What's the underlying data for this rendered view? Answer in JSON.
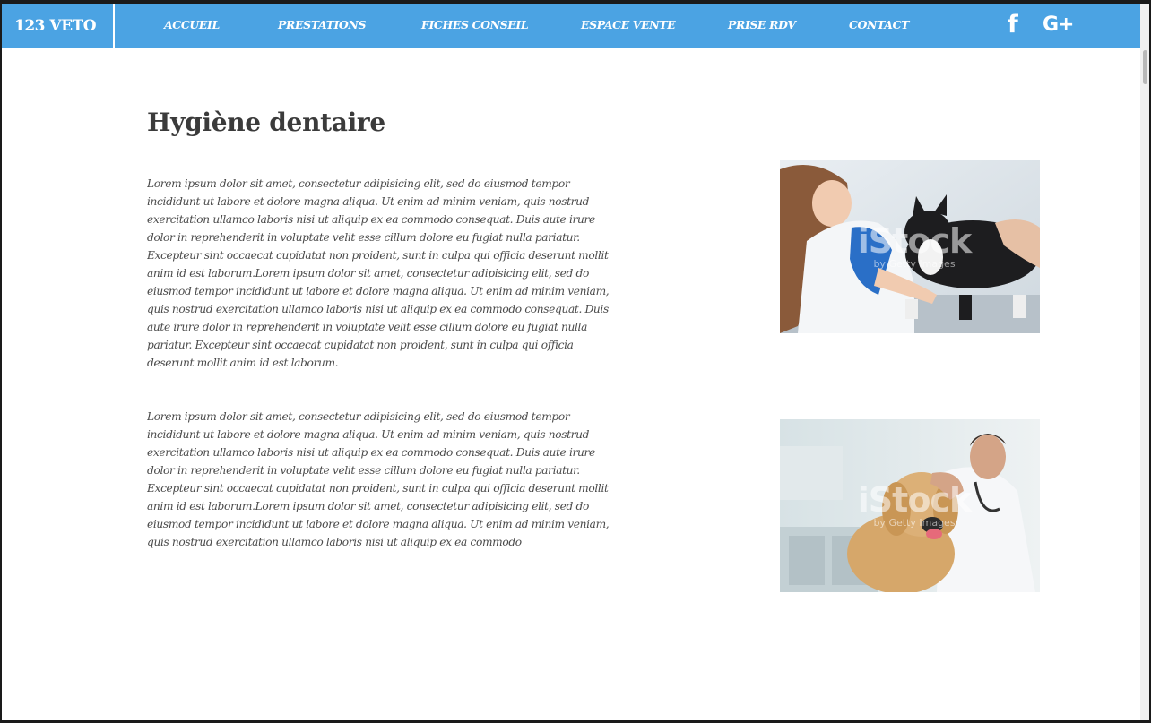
{
  "nav": {
    "brand": "123 VETO",
    "links": [
      "ACCUEIL",
      "PRESTATIONS",
      "FICHES CONSEIL",
      "ESPACE VENTE",
      "PRISE RDV",
      "CONTACT"
    ],
    "social": {
      "facebook": "f",
      "googleplus": "G+"
    }
  },
  "main": {
    "title": "Hygiène dentaire",
    "paragraph1": "Lorem ipsum dolor sit amet, consectetur adipisicing elit, sed do eiusmod tempor incididunt ut labore et dolore magna aliqua. Ut enim ad minim veniam, quis nostrud exercitation ullamco laboris nisi ut aliquip ex ea commodo consequat. Duis aute irure dolor in reprehenderit in voluptate velit esse cillum dolore eu fugiat nulla pariatur. Excepteur sint occaecat cupidatat non proident, sunt in culpa qui officia deserunt mollit anim id est laborum.Lorem ipsum dolor sit amet, consectetur adipisicing elit, sed do eiusmod tempor incididunt ut labore et dolore magna aliqua. Ut enim ad minim veniam, quis nostrud exercitation ullamco laboris nisi ut aliquip ex ea commodo consequat. Duis aute irure dolor in reprehenderit in voluptate velit esse cillum dolore eu fugiat nulla pariatur. Excepteur sint occaecat cupidatat non proident, sunt in culpa qui officia deserunt mollit anim id est laborum.",
    "paragraph2": "Lorem ipsum dolor sit amet, consectetur adipisicing elit, sed do eiusmod tempor incididunt ut labore et dolore magna aliqua. Ut enim ad minim veniam, quis nostrud exercitation ullamco laboris nisi ut aliquip ex ea commodo consequat. Duis aute irure dolor in reprehenderit in voluptate velit esse cillum dolore eu fugiat nulla pariatur. Excepteur sint occaecat cupidatat non proident, sunt in culpa qui officia deserunt mollit anim id est laborum.Lorem ipsum dolor sit amet, consectetur adipisicing elit, sed do eiusmod tempor incididunt ut labore et dolore magna aliqua. Ut enim ad minim veniam, quis nostrud exercitation ullamco laboris nisi ut aliquip ex ea commodo"
  },
  "photos": {
    "watermark_main": "iStock",
    "watermark_sub": "by Getty Images"
  },
  "colors": {
    "navbar": "#4ba3e3",
    "background": "#ffffff",
    "text": "#4a4a4a",
    "title": "#3b3b3b"
  }
}
